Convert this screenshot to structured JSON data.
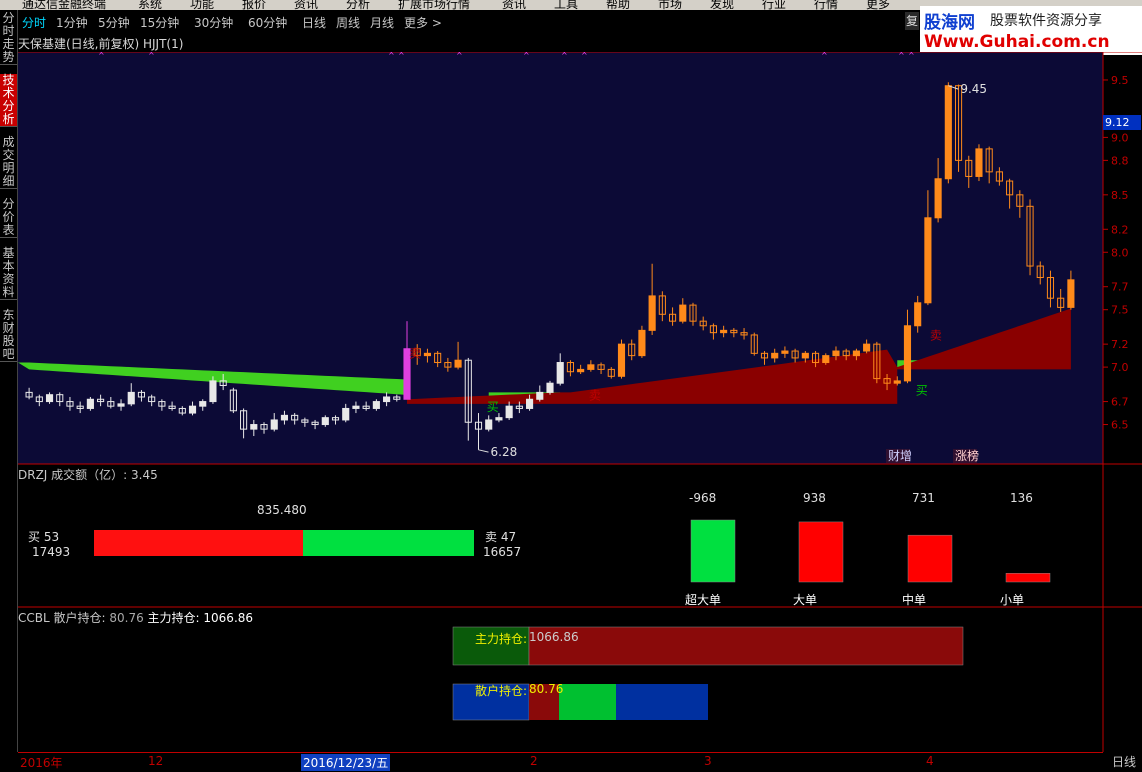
{
  "menu": {
    "title": "通达信金融终端",
    "items": [
      "系统",
      "功能",
      "报价",
      "资讯",
      "分析",
      "扩展市场行情",
      "资讯",
      "工具",
      "帮助",
      "市场",
      "发现",
      "行业",
      "行情",
      "更多"
    ]
  },
  "period_tabs": [
    {
      "label": "分时",
      "active": true
    },
    {
      "label": "1分钟",
      "active": false
    },
    {
      "label": "5分钟",
      "active": false
    },
    {
      "label": "15分钟",
      "active": false
    },
    {
      "label": "30分钟",
      "active": false
    },
    {
      "label": "60分钟",
      "active": false
    },
    {
      "label": "日线",
      "active": false
    },
    {
      "label": "周线",
      "active": false
    },
    {
      "label": "月线",
      "active": false
    },
    {
      "label": "更多 >",
      "active": false
    }
  ],
  "restore_button": "复",
  "sidebar_tabs": [
    {
      "label": "分时走势",
      "active": false
    },
    {
      "label": "技术分析",
      "active": true
    },
    {
      "label": "成交明细",
      "active": false
    },
    {
      "label": "分价表",
      "active": false
    },
    {
      "label": "基本资料",
      "active": false
    },
    {
      "label": "东财股吧",
      "active": false
    }
  ],
  "watermark": {
    "line1_a": "股海网",
    "line1_b": "股票软件资源分享",
    "line2": "Www.Guhai.com.cn"
  },
  "main_chart": {
    "title": "天保基建(日线,前复权) HJJT(1)",
    "high_label": "9.45",
    "low_label": "6.28",
    "current_price_tag": "9.12",
    "y_ticks": [
      "9.5",
      "9.12",
      "9.0",
      "8.8",
      "8.5",
      "8.2",
      "8.0",
      "7.7",
      "7.5",
      "7.2",
      "7.0",
      "6.7",
      "6.5"
    ],
    "signal_sell": "卖",
    "signal_buy": "买",
    "event_labels": [
      "财增",
      "涨榜"
    ],
    "marker_glyph": "×"
  },
  "drzj_panel": {
    "title": "DRZJ  成交额（亿）: 3.45",
    "total": "835.480",
    "buy_label": "买 53",
    "buy_value": "17493",
    "sell_label": "卖 47",
    "sell_value": "16657",
    "buy_ratio": 0.55,
    "bars": [
      {
        "name": "超大单",
        "value": "-968",
        "color": "#00e040"
      },
      {
        "name": "大单",
        "value": "938",
        "color": "#ff0000"
      },
      {
        "name": "中单",
        "value": "731",
        "color": "#ff0000"
      },
      {
        "name": "小单",
        "value": "136",
        "color": "#ff0000"
      }
    ]
  },
  "ccbl_panel": {
    "title_prefix": "CCBL  散户持仓: ",
    "retail_value": "80.76",
    "main_label": "  主力持仓: ",
    "main_value": "1066.86",
    "main_bar_label": "主力持仓:",
    "retail_bar_label": "散户持仓:"
  },
  "date_axis": {
    "year": "2016年",
    "labels": [
      "12",
      "2016/12/23/五",
      "2",
      "3",
      "4"
    ],
    "period": "日线"
  },
  "chart_data": {
    "type": "candlestick",
    "title": "天保基建(日线,前复权) HJJT(1)",
    "ylim": [
      6.2,
      9.7
    ],
    "candles": [
      [
        6.78,
        6.74,
        6.82,
        6.72
      ],
      [
        6.74,
        6.7,
        6.76,
        6.66
      ],
      [
        6.7,
        6.76,
        6.78,
        6.68
      ],
      [
        6.76,
        6.7,
        6.78,
        6.66
      ],
      [
        6.7,
        6.66,
        6.74,
        6.62
      ],
      [
        6.66,
        6.64,
        6.7,
        6.6
      ],
      [
        6.64,
        6.72,
        6.74,
        6.62
      ],
      [
        6.72,
        6.7,
        6.76,
        6.66
      ],
      [
        6.7,
        6.66,
        6.74,
        6.64
      ],
      [
        6.66,
        6.68,
        6.72,
        6.62
      ],
      [
        6.68,
        6.78,
        6.86,
        6.66
      ],
      [
        6.78,
        6.74,
        6.8,
        6.7
      ],
      [
        6.74,
        6.7,
        6.76,
        6.66
      ],
      [
        6.7,
        6.66,
        6.72,
        6.62
      ],
      [
        6.66,
        6.64,
        6.7,
        6.62
      ],
      [
        6.64,
        6.6,
        6.66,
        6.58
      ],
      [
        6.6,
        6.66,
        6.7,
        6.58
      ],
      [
        6.66,
        6.7,
        6.72,
        6.62
      ],
      [
        6.7,
        6.88,
        6.92,
        6.68
      ],
      [
        6.88,
        6.84,
        6.94,
        6.8
      ],
      [
        6.8,
        6.62,
        6.82,
        6.6
      ],
      [
        6.62,
        6.46,
        6.64,
        6.38
      ],
      [
        6.46,
        6.5,
        6.54,
        6.4
      ],
      [
        6.5,
        6.46,
        6.52,
        6.42
      ],
      [
        6.46,
        6.54,
        6.6,
        6.44
      ],
      [
        6.54,
        6.58,
        6.62,
        6.5
      ],
      [
        6.58,
        6.54,
        6.6,
        6.5
      ],
      [
        6.54,
        6.52,
        6.56,
        6.48
      ],
      [
        6.52,
        6.5,
        6.54,
        6.46
      ],
      [
        6.5,
        6.56,
        6.58,
        6.48
      ],
      [
        6.56,
        6.54,
        6.58,
        6.5
      ],
      [
        6.54,
        6.64,
        6.68,
        6.52
      ],
      [
        6.64,
        6.66,
        6.7,
        6.6
      ],
      [
        6.66,
        6.64,
        6.7,
        6.62
      ],
      [
        6.64,
        6.7,
        6.72,
        6.62
      ],
      [
        6.7,
        6.74,
        6.78,
        6.66
      ],
      [
        6.74,
        6.72,
        6.76,
        6.7
      ],
      [
        6.72,
        7.16,
        7.4,
        6.72
      ],
      [
        7.16,
        7.1,
        7.2,
        7.02
      ],
      [
        7.1,
        7.12,
        7.16,
        7.04
      ],
      [
        7.12,
        7.04,
        7.14,
        7.0
      ],
      [
        7.04,
        7.0,
        7.08,
        6.96
      ],
      [
        7.0,
        7.06,
        7.22,
        6.98
      ],
      [
        7.06,
        6.52,
        7.08,
        6.36
      ],
      [
        6.52,
        6.46,
        6.6,
        6.28
      ],
      [
        6.46,
        6.54,
        6.58,
        6.44
      ],
      [
        6.54,
        6.56,
        6.6,
        6.52
      ],
      [
        6.56,
        6.66,
        6.7,
        6.54
      ],
      [
        6.66,
        6.64,
        6.7,
        6.6
      ],
      [
        6.64,
        6.72,
        6.76,
        6.62
      ],
      [
        6.72,
        6.78,
        6.84,
        6.7
      ],
      [
        6.78,
        6.86,
        6.88,
        6.76
      ],
      [
        6.86,
        7.04,
        7.12,
        6.84
      ],
      [
        7.04,
        6.96,
        7.06,
        6.92
      ],
      [
        6.96,
        6.98,
        7.02,
        6.94
      ],
      [
        6.98,
        7.02,
        7.06,
        6.96
      ],
      [
        7.02,
        6.98,
        7.04,
        6.94
      ],
      [
        6.98,
        6.92,
        7.0,
        6.9
      ],
      [
        6.92,
        7.2,
        7.24,
        6.9
      ],
      [
        7.2,
        7.1,
        7.24,
        7.06
      ],
      [
        7.1,
        7.32,
        7.36,
        7.08
      ],
      [
        7.32,
        7.62,
        7.9,
        7.28
      ],
      [
        7.62,
        7.46,
        7.66,
        7.4
      ],
      [
        7.46,
        7.4,
        7.52,
        7.36
      ],
      [
        7.4,
        7.54,
        7.6,
        7.38
      ],
      [
        7.54,
        7.4,
        7.56,
        7.36
      ],
      [
        7.4,
        7.36,
        7.44,
        7.32
      ],
      [
        7.36,
        7.3,
        7.38,
        7.24
      ],
      [
        7.3,
        7.32,
        7.36,
        7.26
      ],
      [
        7.32,
        7.3,
        7.34,
        7.26
      ],
      [
        7.3,
        7.28,
        7.34,
        7.24
      ],
      [
        7.28,
        7.12,
        7.3,
        7.1
      ],
      [
        7.12,
        7.08,
        7.14,
        7.02
      ],
      [
        7.08,
        7.12,
        7.16,
        7.04
      ],
      [
        7.12,
        7.14,
        7.18,
        7.08
      ],
      [
        7.14,
        7.08,
        7.16,
        7.04
      ],
      [
        7.08,
        7.12,
        7.14,
        7.04
      ],
      [
        7.12,
        7.04,
        7.14,
        7.0
      ],
      [
        7.04,
        7.1,
        7.12,
        7.02
      ],
      [
        7.1,
        7.14,
        7.18,
        7.06
      ],
      [
        7.14,
        7.1,
        7.16,
        7.06
      ],
      [
        7.1,
        7.14,
        7.16,
        7.06
      ],
      [
        7.14,
        7.2,
        7.24,
        7.12
      ],
      [
        7.2,
        6.9,
        7.22,
        6.86
      ],
      [
        6.9,
        6.86,
        6.94,
        6.8
      ],
      [
        6.86,
        6.88,
        6.92,
        6.84
      ],
      [
        6.88,
        7.36,
        7.5,
        6.86
      ],
      [
        7.36,
        7.56,
        7.62,
        7.3
      ],
      [
        7.56,
        8.3,
        8.54,
        7.54
      ],
      [
        8.3,
        8.64,
        8.82,
        8.26
      ],
      [
        8.64,
        9.45,
        9.48,
        8.6
      ],
      [
        9.45,
        8.8,
        9.46,
        8.7
      ],
      [
        8.8,
        8.66,
        8.84,
        8.56
      ],
      [
        8.66,
        8.9,
        8.94,
        8.62
      ],
      [
        8.9,
        8.7,
        8.92,
        8.6
      ],
      [
        8.7,
        8.62,
        8.74,
        8.58
      ],
      [
        8.62,
        8.5,
        8.64,
        8.38
      ],
      [
        8.5,
        8.4,
        8.54,
        8.3
      ],
      [
        8.4,
        7.88,
        8.46,
        7.8
      ],
      [
        7.88,
        7.78,
        7.92,
        7.72
      ],
      [
        7.78,
        7.6,
        7.84,
        7.52
      ],
      [
        7.6,
        7.52,
        7.68,
        7.48
      ],
      [
        7.52,
        7.76,
        7.84,
        7.5
      ]
    ]
  }
}
